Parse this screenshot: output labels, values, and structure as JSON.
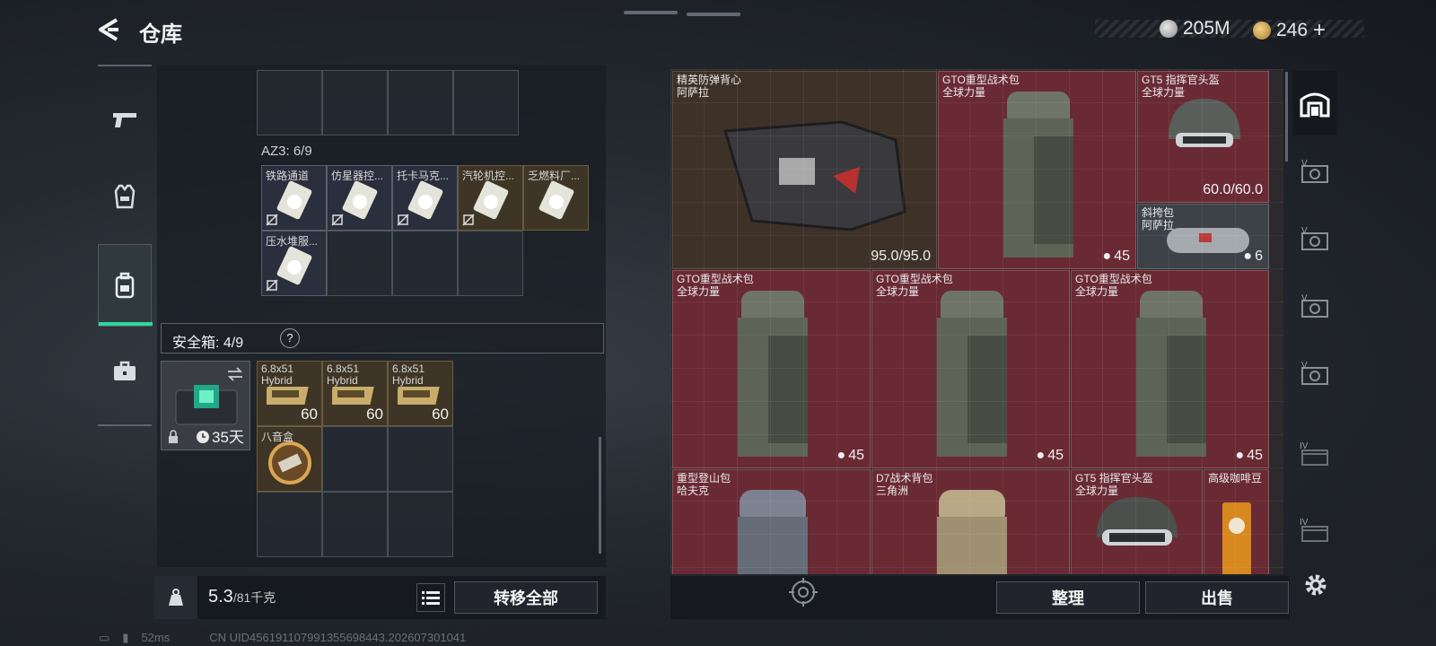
{
  "header": {
    "title": "仓库",
    "currencies": [
      {
        "icon": "coin-silver-icon",
        "value": "205M"
      },
      {
        "icon": "coin-gold-icon",
        "value": "246"
      }
    ],
    "add_label": "+"
  },
  "left_tabs": [
    {
      "icon": "pistol-icon",
      "active": false
    },
    {
      "icon": "vest-icon",
      "active": false
    },
    {
      "icon": "backpack-icon",
      "active": true
    },
    {
      "icon": "briefcase-icon",
      "active": false
    }
  ],
  "backpack": {
    "section_label": "AZ3: 6/9",
    "items": [
      {
        "label": "铁路通道"
      },
      {
        "label": "仿星器控..."
      },
      {
        "label": "托卡马克..."
      },
      {
        "label": "汽轮机控..."
      },
      {
        "label": "乏燃料厂..."
      },
      {
        "label": "压水堆服..."
      }
    ]
  },
  "safe_box": {
    "label": "安全箱: 4/9",
    "help": "?",
    "duration": "35天",
    "items": [
      {
        "label": "6.8x51 Hybrid",
        "count": "60"
      },
      {
        "label": "6.8x51 Hybrid",
        "count": "60"
      },
      {
        "label": "6.8x51 Hybrid",
        "count": "60"
      },
      {
        "label": "八音盒",
        "count": ""
      }
    ]
  },
  "weight": {
    "current": "5.3",
    "max": "/81千克"
  },
  "buttons": {
    "transfer_all": "转移全部",
    "sort": "整理",
    "sell": "出售"
  },
  "storage_items": [
    {
      "name": "精英防弹背心",
      "sub": "阿萨拉",
      "durability": "95.0/95.0"
    },
    {
      "name": "GTO重型战术包",
      "sub": "全球力量",
      "count": "45"
    },
    {
      "name": "GT5 指挥官头盔",
      "sub": "全球力量",
      "durability": "60.0/60.0"
    },
    {
      "name": "斜挎包",
      "sub": "阿萨拉",
      "count": "6"
    },
    {
      "name": "GTO重型战术包",
      "sub": "全球力量",
      "count": "45"
    },
    {
      "name": "GTO重型战术包",
      "sub": "全球力量",
      "count": "45"
    },
    {
      "name": "GTO重型战术包",
      "sub": "全球力量",
      "count": "45"
    },
    {
      "name": "重型登山包",
      "sub": "哈夫克"
    },
    {
      "name": "D7战术背包",
      "sub": "三角洲"
    },
    {
      "name": "GT5 指挥官头盔",
      "sub": "全球力量"
    },
    {
      "name": "高级咖啡豆",
      "sub": ""
    }
  ],
  "side_rail": [
    {
      "icon": "storage-home-icon",
      "label": ""
    },
    {
      "icon": "stash-v-icon",
      "label": "V"
    },
    {
      "icon": "stash-v-icon",
      "label": "V"
    },
    {
      "icon": "stash-v-icon",
      "label": "V"
    },
    {
      "icon": "stash-v-icon",
      "label": "V"
    },
    {
      "icon": "stash-iv-icon",
      "label": "IV"
    },
    {
      "icon": "stash-iv-icon",
      "label": "IV"
    }
  ],
  "status": {
    "ping": "52ms",
    "uid": "CN UID456191107991355698443.202607301041"
  }
}
